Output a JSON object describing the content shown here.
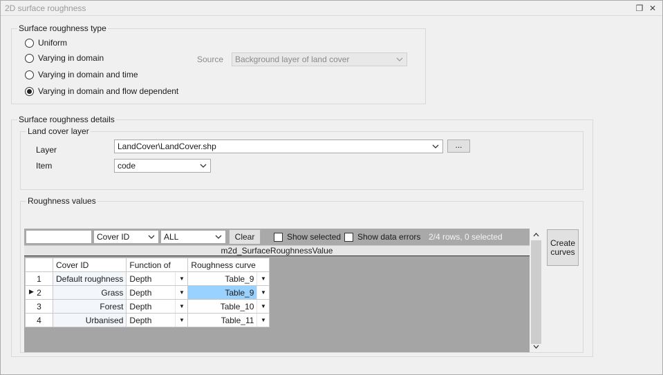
{
  "window": {
    "title": "2D surface roughness",
    "restore_glyph": "❐",
    "close_glyph": "✕"
  },
  "roughness_type": {
    "group_title": "Surface roughness type",
    "options": [
      {
        "label": "Uniform",
        "selected": false
      },
      {
        "label": "Varying in domain",
        "selected": false
      },
      {
        "label": "Varying in domain and time",
        "selected": false
      },
      {
        "label": "Varying in domain and flow dependent",
        "selected": true
      }
    ],
    "source_label": "Source",
    "source_value": "Background layer of land cover"
  },
  "details": {
    "group_title": "Surface roughness details",
    "land_cover": {
      "group_title": "Land cover layer",
      "layer_label": "Layer",
      "layer_value": "LandCover\\LandCover.shp",
      "browse_label": "...",
      "item_label": "Item",
      "item_value": "code"
    },
    "roughness_values": {
      "group_title": "Roughness values",
      "search_value": "",
      "column_filter": "Cover ID",
      "filter_value": "ALL",
      "clear_label": "Clear",
      "show_selected_label": "Show selected",
      "show_errors_label": "Show data errors",
      "status": "2/4 rows, 0 selected",
      "table_title": "m2d_SurfaceRoughnessValue",
      "columns": [
        "Cover ID",
        "Function of",
        "Roughness curve"
      ],
      "rows": [
        {
          "num": "1",
          "cover": "Default roughness",
          "fn": "Depth",
          "curve": "Table_9"
        },
        {
          "num": "2",
          "cover": "Grass",
          "fn": "Depth",
          "curve": "Table_9"
        },
        {
          "num": "3",
          "cover": "Forest",
          "fn": "Depth",
          "curve": "Table_10"
        },
        {
          "num": "4",
          "cover": "Urbanised",
          "fn": "Depth",
          "curve": "Table_11"
        }
      ],
      "create_curves_label_1": "Create",
      "create_curves_label_2": "curves"
    }
  }
}
